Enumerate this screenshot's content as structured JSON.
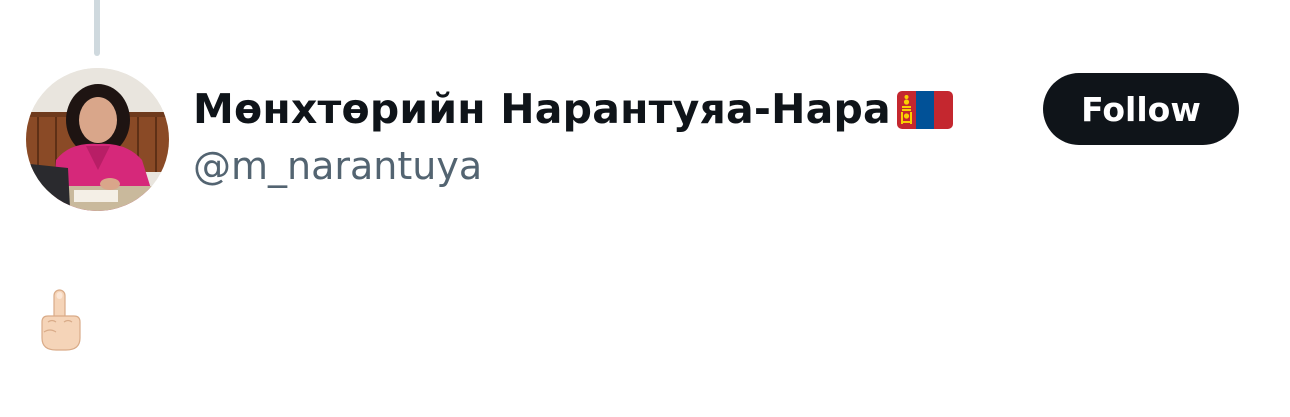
{
  "thread": {
    "connector": true
  },
  "author": {
    "display_name": "Мөнхтөрийн Нарантуяа-Нара",
    "flag_emoji": "mongolia-flag",
    "handle": "@m_narantuya",
    "avatar_description": "profile photo"
  },
  "actions": {
    "follow_label": "Follow"
  },
  "tweet": {
    "text_emoji": "middle-finger-light-skin"
  },
  "colors": {
    "text_primary": "#0f1419",
    "text_secondary": "#536471",
    "button_bg": "#0f1419",
    "button_text": "#ffffff",
    "thread_line": "#cfd9de"
  }
}
